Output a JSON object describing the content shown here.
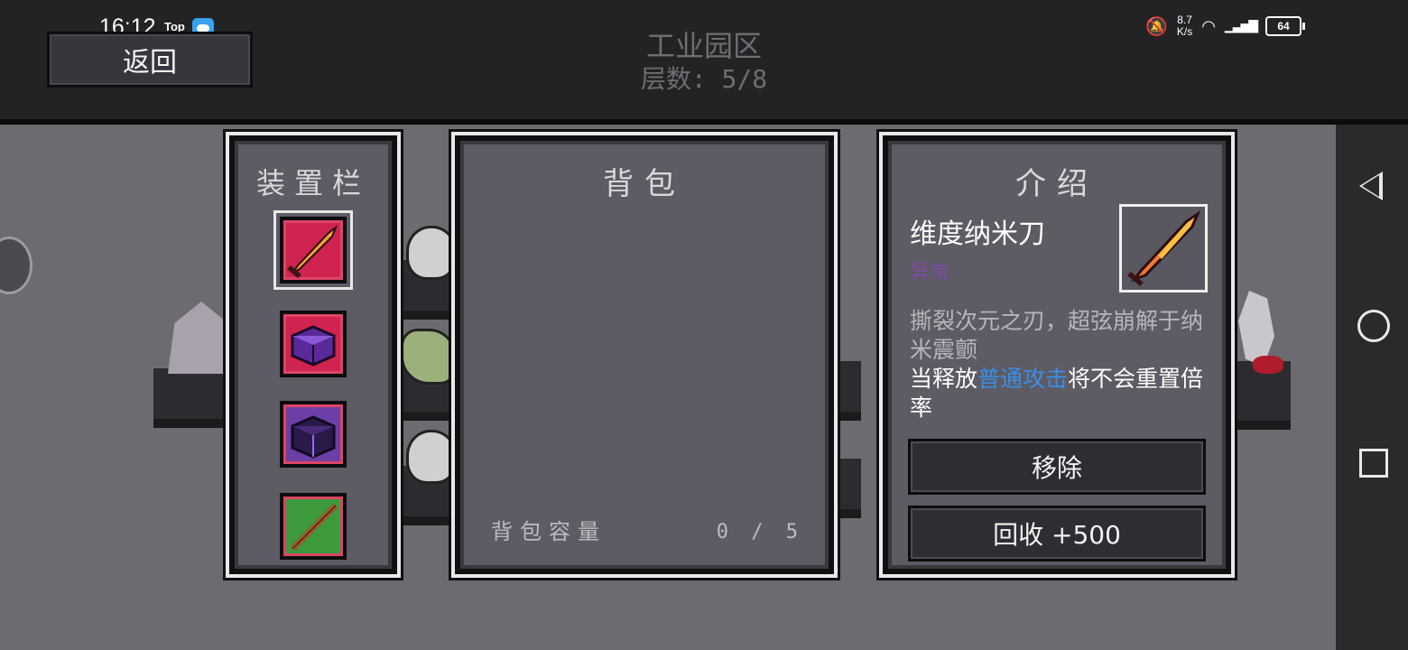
{
  "status_bar": {
    "time": "16:12",
    "top_badge": "Top",
    "net_speed_value": "8.7",
    "net_speed_unit": "K/s",
    "battery": "64"
  },
  "header": {
    "back_label": "返回",
    "area_title": "工业园区",
    "floor_text": "层数: 5/8"
  },
  "equipment_panel": {
    "title": "装置栏",
    "slots": [
      {
        "icon": "red-blade-icon",
        "color": "#d02450",
        "selected": true
      },
      {
        "icon": "purple-cube-icon",
        "color": "#d02450",
        "selected": false
      },
      {
        "icon": "dark-cube-icon",
        "color": "#6b3fa6",
        "selected": false
      },
      {
        "icon": "wooden-staff-icon",
        "color": "#3d9a3d",
        "selected": false
      }
    ]
  },
  "backpack_panel": {
    "title": "背包",
    "capacity_label": "背包容量",
    "capacity_value": "0 / 5"
  },
  "info_panel": {
    "title": "介绍",
    "item_name": "维度纳米刀",
    "rarity": "异常",
    "rarity_color": "#7d4aa4",
    "description_1": "撕裂次元之刃，超弦崩解于纳米震颤",
    "description_2_prefix": "当释放",
    "description_2_keyword": "普通攻击",
    "description_2_suffix": "将不会重置倍率",
    "remove_label": "移除",
    "recycle_label": "回收 +500"
  }
}
